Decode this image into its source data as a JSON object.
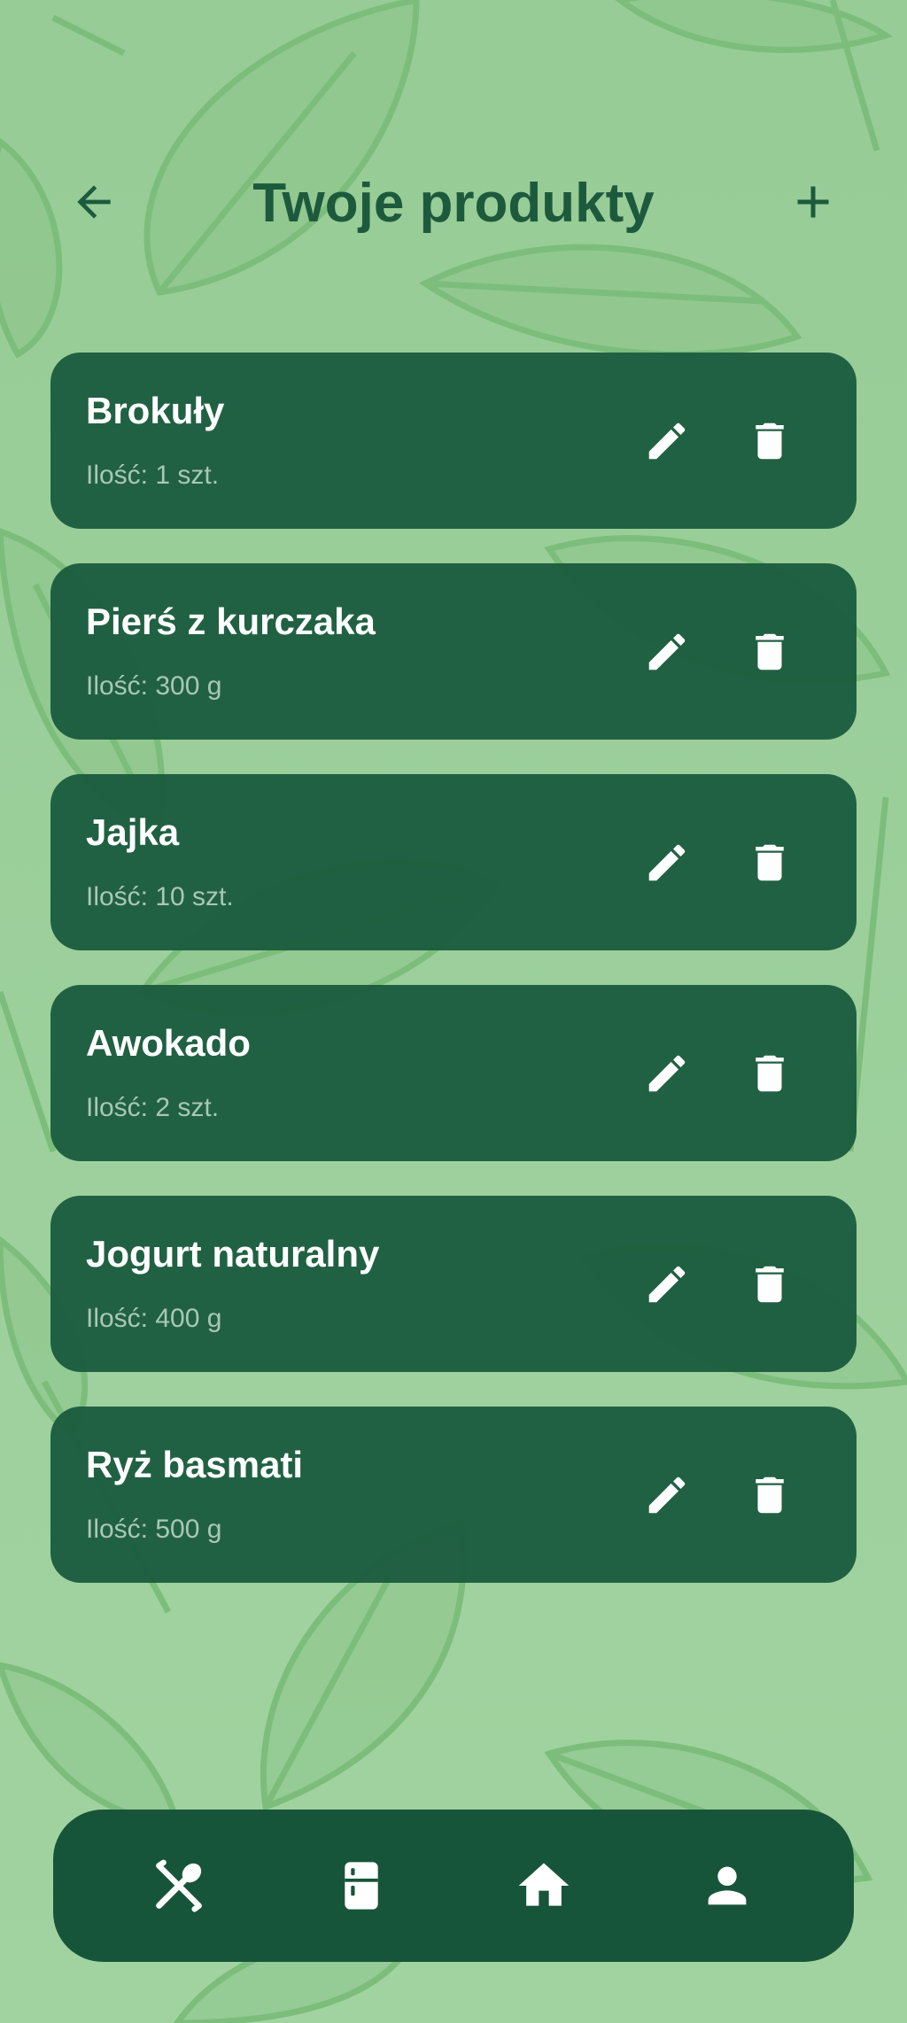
{
  "header": {
    "title": "Twoje produkty",
    "back_icon": "arrow-left-icon",
    "add_icon": "plus-icon"
  },
  "products": [
    {
      "name": "Brokuły",
      "quantity": "Ilość: 1 szt."
    },
    {
      "name": "Pierś z kurczaka",
      "quantity": "Ilość: 300 g"
    },
    {
      "name": "Jajka",
      "quantity": "Ilość: 10 szt."
    },
    {
      "name": "Awokado",
      "quantity": "Ilość: 2 szt."
    },
    {
      "name": "Jogurt naturalny",
      "quantity": "Ilość: 400 g"
    },
    {
      "name": "Ryż basmati",
      "quantity": "Ilość: 500 g"
    }
  ],
  "card_actions": {
    "edit_icon": "pencil-icon",
    "delete_icon": "trash-icon"
  },
  "bottom_nav": {
    "items": [
      {
        "icon": "utensils-icon"
      },
      {
        "icon": "fridge-icon"
      },
      {
        "icon": "home-icon"
      },
      {
        "icon": "person-icon"
      }
    ]
  },
  "colors": {
    "background": "#9ccd9a",
    "leaf_stroke": "#7fbf7e",
    "card": "#18583c",
    "title": "#1d5a3d",
    "nav": "#17553a",
    "quantity_text": "#a9c7b5"
  }
}
